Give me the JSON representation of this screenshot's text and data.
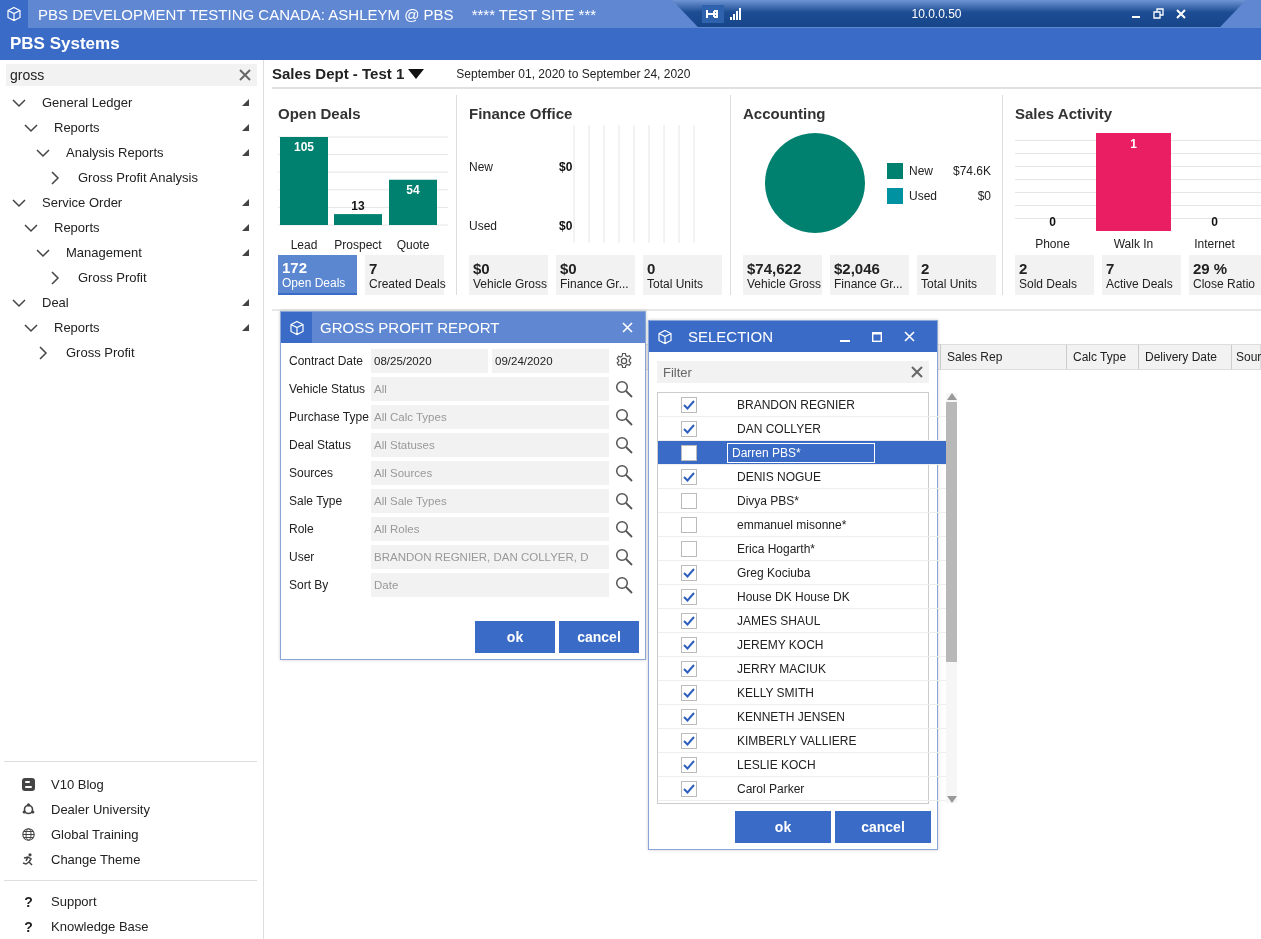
{
  "titlebar": {
    "title": "PBS DEVELOPMENT TESTING CANADA: ASHLEYM @ PBS",
    "site": "**** TEST SITE ***"
  },
  "remote_bar": {
    "address": "10.0.0.50"
  },
  "app_bar": {
    "title": "PBS Systems"
  },
  "sidebar": {
    "search": {
      "value": "gross"
    },
    "tree": [
      {
        "label": "General Ledger",
        "expanded": true,
        "children": [
          {
            "label": "Reports",
            "expanded": true,
            "children": [
              {
                "label": "Analysis Reports",
                "expanded": true,
                "children": [
                  {
                    "label": "Gross Profit Analysis",
                    "expanded": false
                  }
                ]
              }
            ]
          }
        ]
      },
      {
        "label": "Service Order",
        "expanded": true,
        "children": [
          {
            "label": "Reports",
            "expanded": true,
            "children": [
              {
                "label": "Management",
                "expanded": true,
                "children": [
                  {
                    "label": "Gross Profit",
                    "expanded": false
                  }
                ]
              }
            ]
          }
        ]
      },
      {
        "label": "Deal",
        "expanded": true,
        "children": [
          {
            "label": "Reports",
            "expanded": true,
            "children": [
              {
                "label": "Gross Profit",
                "expanded": false
              }
            ]
          }
        ]
      }
    ],
    "links": [
      {
        "kind": "blog",
        "label": "V10 Blog"
      },
      {
        "kind": "university",
        "label": "Dealer University"
      },
      {
        "kind": "globe",
        "label": "Global Training"
      },
      {
        "kind": "theme",
        "label": "Change Theme"
      }
    ],
    "help_links": [
      {
        "glyph": "?",
        "label": "Support"
      },
      {
        "glyph": "?",
        "label": "Knowledge Base"
      }
    ]
  },
  "header": {
    "department": "Sales Dept - Test 1",
    "date_range": "September 01, 2020 to September 24, 2020"
  },
  "panels": [
    {
      "title": "Open Deals",
      "chart_data": {
        "type": "bar",
        "categories": [
          "Lead",
          "Prospect",
          "Quote"
        ],
        "series": [
          {
            "color": "#00806f",
            "values": [
              105,
              13,
              54
            ]
          }
        ],
        "data_labels": true
      },
      "tiles": [
        {
          "value": "172",
          "label": "Open Deals",
          "selected": true
        },
        {
          "value": "7",
          "label": "Created Deals",
          "selected": false
        }
      ]
    },
    {
      "title": "Finance Office",
      "rows": [
        {
          "label": "New",
          "value": "$0"
        },
        {
          "label": "Used",
          "value": "$0"
        }
      ],
      "tiles": [
        {
          "value": "$0",
          "label": "Vehicle Gross",
          "selected": false
        },
        {
          "value": "$0",
          "label": "Finance Gr...",
          "selected": false
        },
        {
          "value": "0",
          "label": "Total Units",
          "selected": false
        }
      ]
    },
    {
      "title": "Accounting",
      "chart_data": {
        "type": "pie",
        "categories": [
          "New",
          "Used"
        ],
        "series": [
          {
            "values": [
              100,
              0
            ]
          }
        ],
        "value_labels": [
          "$74.6K",
          "$0"
        ]
      },
      "legend": [
        {
          "color": "#00806f"
        },
        {
          "color": "#0092a0"
        }
      ],
      "tiles": [
        {
          "value": "$74,622",
          "label": "Vehicle Gross",
          "selected": false
        },
        {
          "value": "$2,046",
          "label": "Finance Gr...",
          "selected": false
        },
        {
          "value": "2",
          "label": "Total Units",
          "selected": false
        }
      ]
    },
    {
      "title": "Sales Activity",
      "bars": [
        {
          "label": "Phone",
          "value": "0"
        },
        {
          "label": "Walk In",
          "value": "1"
        },
        {
          "label": "Internet",
          "value": "0"
        }
      ],
      "tiles": [
        {
          "value": "2",
          "label": "Sold Deals",
          "selected": false
        },
        {
          "value": "7",
          "label": "Active Deals",
          "selected": false
        },
        {
          "value": "29 %",
          "label": "Close Ratio",
          "selected": false
        }
      ]
    }
  ],
  "table": {
    "columns": [
      "Sales Rep",
      "Calc Type",
      "Delivery Date",
      "Sour"
    ]
  },
  "report_dialog": {
    "title": "GROSS PROFIT REPORT",
    "rows": [
      {
        "label": "Contract Date",
        "kind": "dates",
        "fields": [
          {
            "value": "08/25/2020"
          },
          {
            "value": "09/24/2020"
          }
        ]
      },
      {
        "label": "Vehicle Status",
        "kind": "lookup",
        "fields": [
          {
            "placeholder": "All"
          }
        ]
      },
      {
        "label": "Purchase Type",
        "kind": "lookup",
        "fields": [
          {
            "placeholder": "All Calc Types"
          }
        ]
      },
      {
        "label": "Deal Status",
        "kind": "lookup",
        "fields": [
          {
            "placeholder": "All Statuses"
          }
        ]
      },
      {
        "label": "Sources",
        "kind": "lookup",
        "fields": [
          {
            "placeholder": "All Sources"
          }
        ]
      },
      {
        "label": "Sale Type",
        "kind": "lookup",
        "fields": [
          {
            "placeholder": "All Sale Types"
          }
        ]
      },
      {
        "label": "Role",
        "kind": "lookup",
        "fields": [
          {
            "placeholder": "All Roles"
          }
        ]
      },
      {
        "label": "User",
        "kind": "lookup",
        "fields": [
          {
            "placeholder": "BRANDON REGNIER, DAN COLLYER, D"
          }
        ]
      },
      {
        "label": "Sort By",
        "kind": "lookup",
        "fields": [
          {
            "placeholder": "Date"
          }
        ]
      }
    ],
    "buttons": [
      "ok",
      "cancel"
    ]
  },
  "selection_dialog": {
    "title": "SELECTION",
    "filter": {
      "placeholder": "Filter"
    },
    "items": [
      {
        "name": "BRANDON REGNIER",
        "checked": true,
        "selected": false
      },
      {
        "name": "DAN COLLYER",
        "checked": true,
        "selected": false
      },
      {
        "name": "Darren PBS*",
        "checked": false,
        "selected": true
      },
      {
        "name": "DENIS NOGUE",
        "checked": true,
        "selected": false
      },
      {
        "name": "Divya PBS*",
        "checked": false,
        "selected": false
      },
      {
        "name": "emmanuel misonne*",
        "checked": false,
        "selected": false
      },
      {
        "name": "Erica Hogarth*",
        "checked": false,
        "selected": false
      },
      {
        "name": "Greg Kociuba",
        "checked": true,
        "selected": false
      },
      {
        "name": "House DK House DK",
        "checked": true,
        "selected": false
      },
      {
        "name": "JAMES SHAUL",
        "checked": true,
        "selected": false
      },
      {
        "name": "JEREMY KOCH",
        "checked": true,
        "selected": false
      },
      {
        "name": "JERRY MACIUK",
        "checked": true,
        "selected": false
      },
      {
        "name": "KELLY SMITH",
        "checked": true,
        "selected": false
      },
      {
        "name": "KENNETH JENSEN",
        "checked": true,
        "selected": false
      },
      {
        "name": "KIMBERLY VALLIERE",
        "checked": true,
        "selected": false
      },
      {
        "name": "LESLIE KOCH",
        "checked": true,
        "selected": false
      },
      {
        "name": "Carol Parker",
        "checked": true,
        "selected": false
      }
    ],
    "buttons": [
      "ok",
      "cancel"
    ]
  }
}
